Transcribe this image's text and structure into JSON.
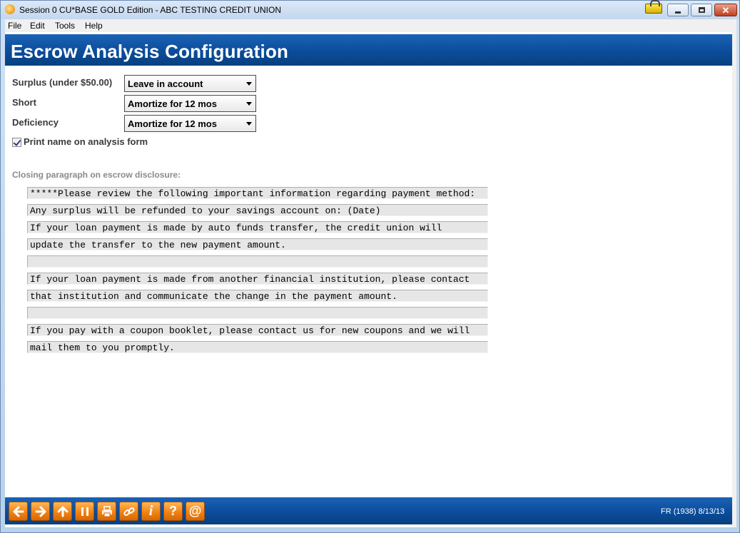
{
  "window": {
    "title": "Session 0 CU*BASE GOLD Edition - ABC TESTING CREDIT UNION",
    "close_glyph": "✕"
  },
  "menu": [
    "File",
    "Edit",
    "Tools",
    "Help"
  ],
  "page": {
    "title": "Escrow Analysis Configuration"
  },
  "form": {
    "surplus_label": "Surplus (under $50.00)",
    "surplus_value": "Leave in account",
    "short_label": "Short",
    "short_value": "Amortize for 12 mos",
    "deficiency_label": "Deficiency",
    "deficiency_value": "Amortize for 12 mos",
    "print_name_label": "Print name on analysis form",
    "print_name_checked": true,
    "closing_label": "Closing paragraph on escrow disclosure:",
    "closing_lines": [
      "*****Please review the following important information regarding payment method:",
      "Any surplus will be refunded to your savings account on: (Date)",
      "If your loan payment is made by auto funds transfer, the credit union will",
      "update the transfer to the new payment amount.",
      "",
      "If your loan payment is made from another financial institution, please contact",
      "that institution and communicate the change in the payment amount.",
      "",
      "If you pay with a coupon booklet, please contact us for new coupons and we will",
      "mail them to you promptly."
    ]
  },
  "toolbar": {
    "buttons": [
      {
        "icon": "back-arrow-icon"
      },
      {
        "icon": "forward-arrow-icon"
      },
      {
        "icon": "up-arrow-icon"
      },
      {
        "icon": "pause-icon"
      },
      {
        "icon": "print-icon"
      },
      {
        "icon": "link-icon"
      },
      {
        "icon": "info-icon",
        "glyph": "i"
      },
      {
        "icon": "help-icon",
        "glyph": "?"
      },
      {
        "icon": "email-icon",
        "glyph": "@"
      }
    ],
    "status": "FR (1938) 8/13/13"
  }
}
